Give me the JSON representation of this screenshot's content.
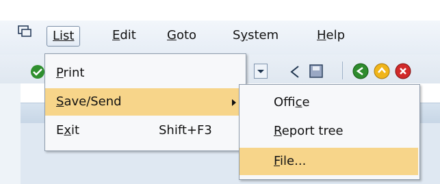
{
  "menubar": {
    "items": [
      {
        "name": "menu-list",
        "label": "List",
        "mnemonic_index": 0,
        "active": true
      },
      {
        "name": "menu-edit",
        "label": "Edit",
        "mnemonic_index": 0,
        "active": false
      },
      {
        "name": "menu-goto",
        "label": "Goto",
        "mnemonic_index": 0,
        "active": false
      },
      {
        "name": "menu-system",
        "label": "System",
        "mnemonic_index": 1,
        "active": false
      },
      {
        "name": "menu-help",
        "label": "Help",
        "mnemonic_index": 0,
        "active": false
      }
    ]
  },
  "list_menu": {
    "items": [
      {
        "label_pre": "",
        "label_u": "P",
        "label_post": "rint",
        "shortcut": "",
        "highlighted": false,
        "has_submenu": false
      },
      {
        "label_pre": "",
        "label_u": "S",
        "label_post": "ave/Send",
        "shortcut": "",
        "highlighted": true,
        "has_submenu": true
      },
      {
        "label_pre": "E",
        "label_u": "x",
        "label_post": "it",
        "shortcut": "Shift+F3",
        "highlighted": false,
        "has_submenu": false
      }
    ]
  },
  "save_send_menu": {
    "items": [
      {
        "label_pre": "Offi",
        "label_u": "c",
        "label_post": "e",
        "highlighted": false
      },
      {
        "label_pre": "",
        "label_u": "R",
        "label_post": "eport tree",
        "highlighted": false
      },
      {
        "label_pre": "",
        "label_u": "F",
        "label_post": "ile...",
        "highlighted": true
      }
    ]
  },
  "colors": {
    "highlight": "#f7d58a",
    "menu_bg": "#f7f8fa",
    "menubar_bg": "#eef3f8"
  },
  "icons": [
    "system-menu-icon",
    "green-check-icon",
    "dropdown-arrow-icon",
    "back-arrow-icon",
    "save-icon",
    "green-back-icon",
    "yellow-exit-icon",
    "red-cancel-icon"
  ]
}
